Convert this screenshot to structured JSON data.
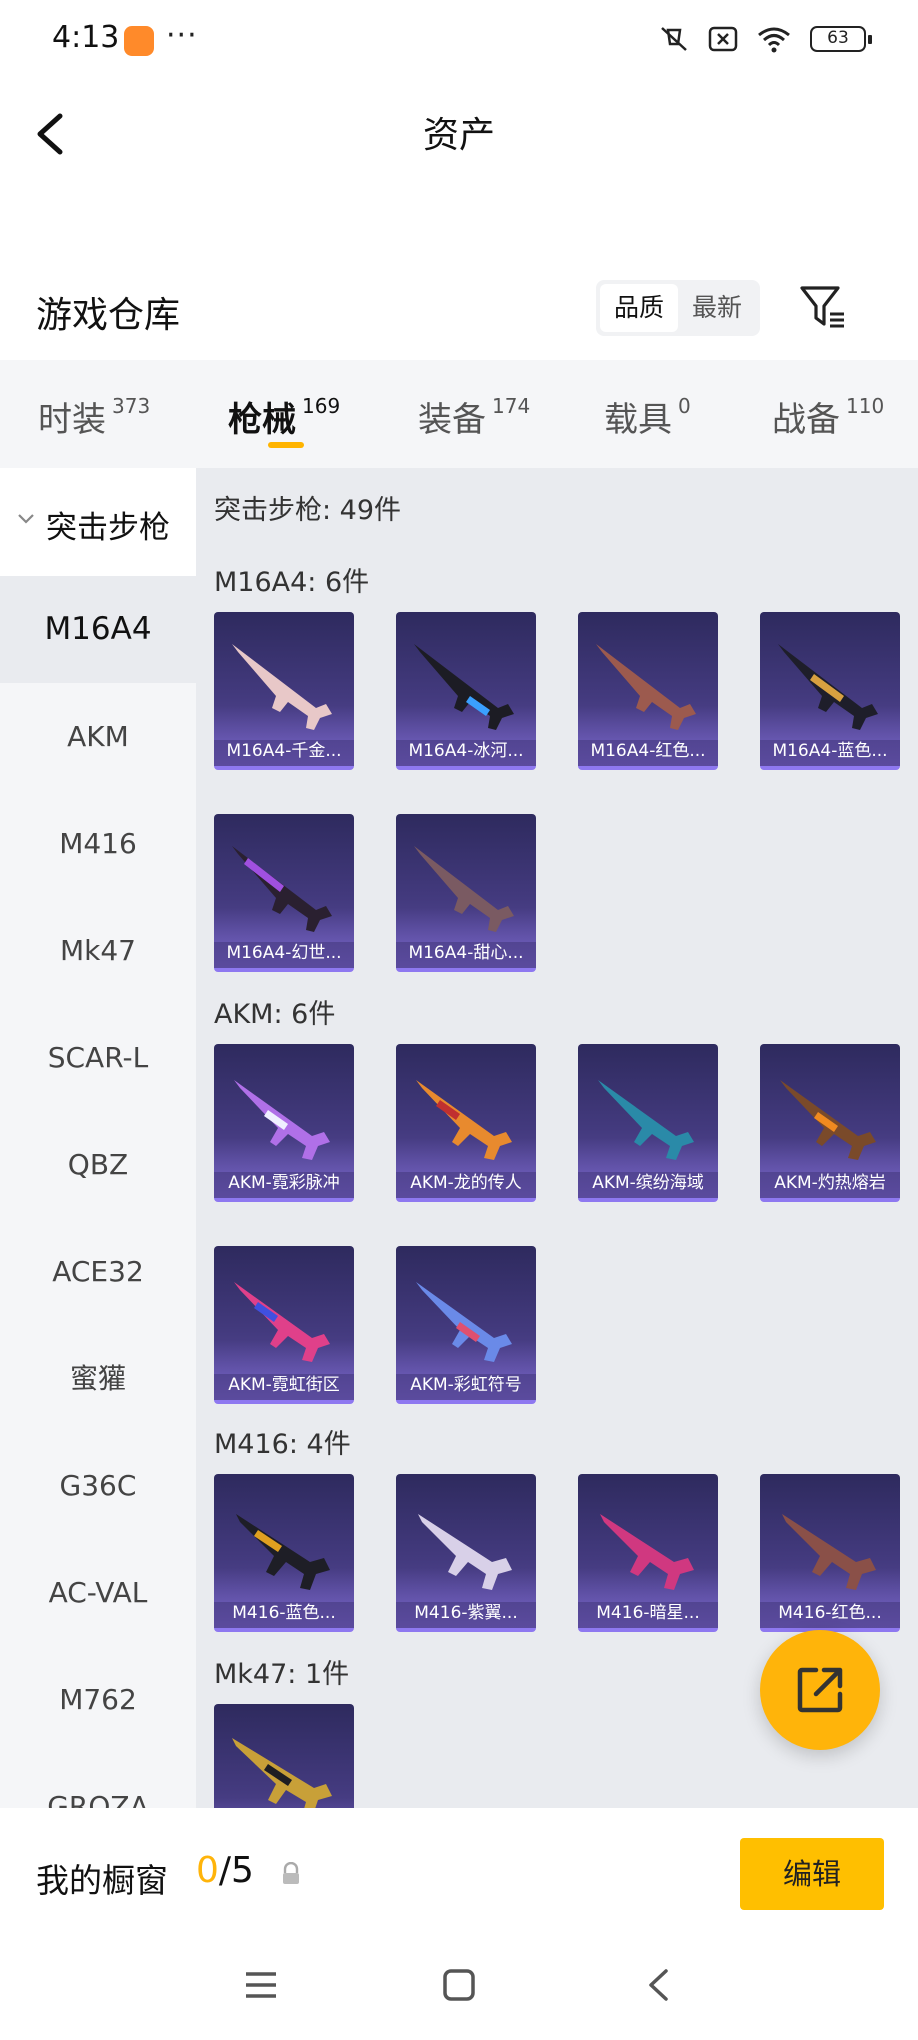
{
  "status_bar": {
    "time": "4:13",
    "battery": "63"
  },
  "header": {
    "title": "资产"
  },
  "warehouse": {
    "title": "游戏仓库",
    "sort_options": [
      "品质",
      "最新"
    ],
    "active_sort": "品质"
  },
  "tabs": [
    {
      "label": "时装",
      "count": "373"
    },
    {
      "label": "枪械",
      "count": "169",
      "active": true
    },
    {
      "label": "装备",
      "count": "174"
    },
    {
      "label": "载具",
      "count": "0"
    },
    {
      "label": "战备",
      "count": "110"
    }
  ],
  "sidebar": {
    "category": "突击步枪",
    "items": [
      "M16A4",
      "AKM",
      "M416",
      "Mk47",
      "SCAR-L",
      "QBZ",
      "ACE32",
      "蜜獾",
      "G36C",
      "AC-VAL",
      "M762",
      "GROZA"
    ],
    "selected": "M16A4"
  },
  "content": {
    "category_header": "突击步枪: 49件",
    "groups": [
      {
        "title": "M16A4: 6件",
        "items": [
          "M16A4-千金...",
          "M16A4-冰河...",
          "M16A4-红色...",
          "M16A4-蓝色...",
          "M16A4-幻世...",
          "M16A4-甜心..."
        ]
      },
      {
        "title": "AKM: 6件",
        "items": [
          "AKM-霓彩脉冲",
          "AKM-龙的传人",
          "AKM-缤纷海域",
          "AKM-灼热熔岩",
          "AKM-霓虹街区",
          "AKM-彩虹符号"
        ]
      },
      {
        "title": "M416: 4件",
        "items": [
          "M416-蓝色...",
          "M416-紫翼...",
          "M416-暗星...",
          "M416-红色..."
        ]
      },
      {
        "title": "Mk47: 1件",
        "items": [
          ""
        ]
      }
    ]
  },
  "showcase": {
    "title": "我的橱窗",
    "current": "0",
    "total": "/5",
    "edit_label": "编辑"
  },
  "colors": {
    "accent": "#ffb400",
    "card_top": "#2e2a5e",
    "card_bottom": "#5b4b9e",
    "content_bg": "#e9ebef"
  }
}
